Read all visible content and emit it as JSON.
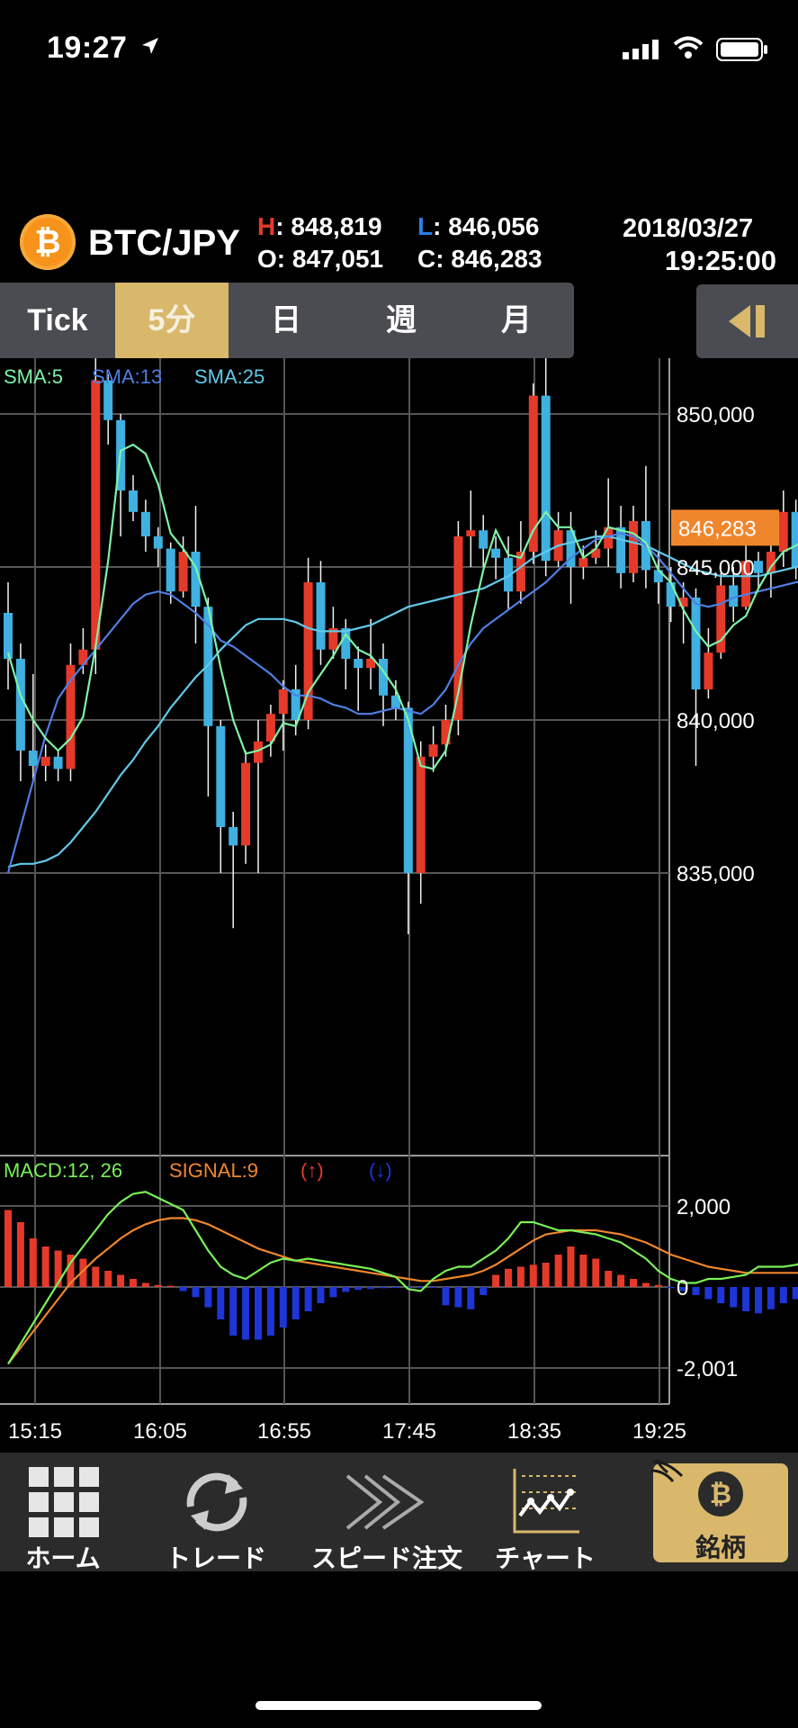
{
  "status_bar": {
    "time": "19:27"
  },
  "header": {
    "coin_symbol": "₿",
    "pair": "BTC/JPY",
    "high_key": "H",
    "high_value": ": 848,819",
    "low_key": "L",
    "low_value": ": 846,056",
    "open_key": "O",
    "open_value": ": 847,051",
    "close_key": "C",
    "close_value": ": 846,283",
    "date": "2018/03/27",
    "time": "19:25:00"
  },
  "tabs": [
    {
      "label": "Tick",
      "active": false
    },
    {
      "label": "5分",
      "active": true
    },
    {
      "label": "日",
      "active": false
    },
    {
      "label": "週",
      "active": false
    },
    {
      "label": "月",
      "active": false
    }
  ],
  "colors": {
    "up": "#e53a2a",
    "down": "#3fb0e0",
    "macd_pos": "#e53a2a",
    "macd_neg": "#1e35d8",
    "sma5": "#7ef2a6",
    "sma13": "#4f7fe3",
    "sma25": "#62c9e8",
    "macd_line": "#7af058",
    "signal_line": "#f0862c",
    "current_price_bg": "#f0862c",
    "accent_gold": "#d9b86c"
  },
  "chart_data": [
    {
      "type": "candlestick",
      "legend": [
        "SMA:5",
        "SMA:13",
        "SMA:25"
      ],
      "y_ticks": [
        "850,000",
        "845,000",
        "840,000",
        "835,000"
      ],
      "ylim": [
        832000,
        852000
      ],
      "current_price": "846,283",
      "x_ticks": [
        "15:15",
        "16:05",
        "16:55",
        "17:45",
        "18:35",
        "19:25"
      ],
      "candles": [
        [
          843500,
          842000,
          844500,
          841000
        ],
        [
          842000,
          839000,
          842500,
          838000
        ],
        [
          839000,
          838500,
          841500,
          838000
        ],
        [
          838500,
          838800,
          839200,
          838000
        ],
        [
          838800,
          838400,
          839000,
          838000
        ],
        [
          838400,
          841800,
          842500,
          838000
        ],
        [
          841800,
          842300,
          843000,
          841500
        ],
        [
          842300,
          851100,
          852500,
          841500
        ],
        [
          851100,
          849800,
          851300,
          849000
        ],
        [
          849800,
          847500,
          850000,
          846000
        ],
        [
          847500,
          846800,
          848000,
          846500
        ],
        [
          846800,
          846000,
          847200,
          845500
        ],
        [
          846000,
          845600,
          846300,
          845000
        ],
        [
          845600,
          844200,
          845800,
          843800
        ],
        [
          844200,
          845500,
          846000,
          844000
        ],
        [
          845500,
          843700,
          847000,
          842500
        ],
        [
          843700,
          839800,
          844000,
          837500
        ],
        [
          839800,
          836500,
          840000,
          835000
        ],
        [
          836500,
          835900,
          837000,
          833200
        ],
        [
          835900,
          838600,
          839000,
          835300
        ],
        [
          838600,
          839300,
          840000,
          835000
        ],
        [
          839300,
          840200,
          840500,
          838800
        ],
        [
          840200,
          841000,
          841300,
          839000
        ],
        [
          841000,
          840000,
          841800,
          839500
        ],
        [
          840000,
          844500,
          845300,
          839700
        ],
        [
          844500,
          842300,
          845200,
          841800
        ],
        [
          842300,
          843000,
          843700,
          842000
        ],
        [
          843000,
          842000,
          843300,
          841000
        ],
        [
          842000,
          841700,
          842400,
          840300
        ],
        [
          841700,
          842000,
          843300,
          841000
        ],
        [
          842000,
          840800,
          842500,
          839800
        ],
        [
          840800,
          840400,
          841300,
          840000
        ],
        [
          840400,
          835000,
          840600,
          833000
        ],
        [
          835000,
          838800,
          839300,
          834000
        ],
        [
          838800,
          839200,
          839800,
          838300
        ],
        [
          839200,
          840000,
          840500,
          838800
        ],
        [
          840000,
          846000,
          846500,
          839500
        ],
        [
          846000,
          846200,
          847500,
          845000
        ],
        [
          846200,
          845600,
          846700,
          845000
        ],
        [
          845600,
          845300,
          846000,
          844600
        ],
        [
          845300,
          844200,
          846000,
          843600
        ],
        [
          844200,
          845500,
          846500,
          843800
        ],
        [
          845500,
          850600,
          851000,
          845100
        ],
        [
          850600,
          845200,
          852000,
          844700
        ],
        [
          845200,
          846200,
          846800,
          845000
        ],
        [
          846200,
          845000,
          846800,
          843800
        ],
        [
          845000,
          845300,
          845700,
          844600
        ],
        [
          845300,
          845600,
          846200,
          845100
        ],
        [
          845600,
          846300,
          847900,
          845000
        ],
        [
          846300,
          844800,
          847000,
          844300
        ],
        [
          844800,
          846500,
          847000,
          844500
        ],
        [
          846500,
          844900,
          848300,
          844300
        ],
        [
          844900,
          844500,
          845500,
          843800
        ],
        [
          844500,
          843700,
          845000,
          843200
        ],
        [
          843700,
          844000,
          844500,
          842500
        ],
        [
          844000,
          841000,
          844300,
          838500
        ],
        [
          841000,
          842200,
          843000,
          840700
        ],
        [
          842200,
          844400,
          844800,
          842000
        ],
        [
          844400,
          843700,
          845000,
          843200
        ],
        [
          843700,
          845200,
          845700,
          843600
        ],
        [
          845200,
          844800,
          845500,
          844300
        ],
        [
          844800,
          845500,
          846000,
          844000
        ],
        [
          845500,
          846800,
          847500,
          845000
        ],
        [
          846800,
          845000,
          847200,
          844600
        ],
        [
          845000,
          846400,
          847300,
          844800
        ],
        [
          846400,
          847100,
          847600,
          846000
        ],
        [
          847100,
          846300,
          848800,
          846100
        ]
      ],
      "sma5": [
        842200,
        840800,
        840000,
        839400,
        839000,
        839400,
        840100,
        842400,
        845200,
        848800,
        849000,
        848700,
        847700,
        846100,
        845600,
        845000,
        843700,
        841700,
        840000,
        838900,
        839000,
        839200,
        839900,
        839800,
        840900,
        841500,
        842100,
        842800,
        842300,
        842100,
        841600,
        841000,
        840000,
        838500,
        838400,
        839000,
        840900,
        843100,
        844900,
        846200,
        845400,
        845300,
        846200,
        846800,
        846300,
        846300,
        845300,
        845600,
        846300,
        846200,
        846100,
        845800,
        844900,
        844500,
        843600,
        842900,
        842400,
        842600,
        843100,
        843400,
        844300,
        845000,
        845500,
        845700,
        846000,
        846500,
        846600
      ],
      "sma13": [
        835000,
        836500,
        838000,
        839500,
        840700,
        841300,
        841800,
        842300,
        842800,
        843300,
        843800,
        844100,
        844200,
        844100,
        843800,
        843500,
        843100,
        842600,
        842400,
        842100,
        841800,
        841500,
        841100,
        840800,
        840800,
        840700,
        840500,
        840400,
        840200,
        840200,
        840300,
        840400,
        840300,
        840200,
        840500,
        841000,
        841800,
        842500,
        843000,
        843300,
        843600,
        843900,
        844200,
        844500,
        844900,
        845300,
        845600,
        845900,
        846000,
        846100,
        846000,
        845700,
        845300,
        844800,
        844300,
        843800,
        843700,
        843800,
        844000,
        844100,
        844200,
        844300,
        844400,
        844500,
        844600,
        844700,
        844800
      ],
      "sma25": [
        835200,
        835300,
        835300,
        835400,
        835600,
        836000,
        836500,
        837000,
        837600,
        838200,
        838700,
        839300,
        839800,
        840400,
        840900,
        841400,
        841800,
        842300,
        842700,
        843100,
        843300,
        843300,
        843300,
        843200,
        843000,
        842900,
        842900,
        842900,
        843000,
        843100,
        843300,
        843500,
        843700,
        843800,
        843900,
        844000,
        844100,
        844200,
        844300,
        844500,
        844700,
        845000,
        845300,
        845500,
        845700,
        845800,
        845900,
        846000,
        846000,
        845900,
        845800,
        845700,
        845500,
        845300,
        845100,
        844900,
        844800,
        844700,
        844700,
        844700,
        844700,
        844800,
        844900,
        845000,
        845100,
        845200,
        845300
      ]
    },
    {
      "type": "macd",
      "legend": [
        "MACD:12, 26",
        "SIGNAL:9",
        "(↑)",
        "(↓)"
      ],
      "y_ticks": [
        "2,000",
        "0",
        "-2,001"
      ],
      "ylim": [
        -2001,
        2000
      ],
      "macd": [
        -1900,
        -1400,
        -900,
        -400,
        100,
        600,
        1000,
        1400,
        1800,
        2100,
        2300,
        2350,
        2200,
        2050,
        1900,
        1400,
        900,
        500,
        300,
        200,
        400,
        600,
        700,
        650,
        700,
        650,
        600,
        550,
        500,
        450,
        350,
        250,
        -50,
        -100,
        200,
        400,
        500,
        500,
        700,
        900,
        1200,
        1600,
        1600,
        1500,
        1400,
        1400,
        1350,
        1300,
        1200,
        1100,
        900,
        700,
        400,
        200,
        100,
        100,
        200,
        200,
        250,
        300,
        500,
        500,
        500,
        550,
        650,
        700,
        750
      ],
      "signal": [
        -1900,
        -1500,
        -1100,
        -700,
        -300,
        100,
        400,
        700,
        950,
        1200,
        1400,
        1550,
        1650,
        1700,
        1700,
        1650,
        1550,
        1400,
        1250,
        1100,
        950,
        850,
        750,
        650,
        600,
        550,
        500,
        450,
        400,
        350,
        300,
        250,
        200,
        150,
        150,
        200,
        250,
        300,
        400,
        550,
        750,
        950,
        1150,
        1300,
        1350,
        1400,
        1400,
        1400,
        1350,
        1300,
        1200,
        1100,
        950,
        800,
        700,
        600,
        500,
        450,
        400,
        350,
        350,
        350,
        350,
        350,
        350,
        350,
        350
      ],
      "histogram": [
        1900,
        1600,
        1200,
        1000,
        900,
        800,
        700,
        500,
        400,
        300,
        200,
        100,
        50,
        30,
        -100,
        -250,
        -500,
        -800,
        -1200,
        -1300,
        -1300,
        -1200,
        -1000,
        -800,
        -600,
        -400,
        -250,
        -120,
        -70,
        -50,
        -30,
        -20,
        -10,
        -10,
        -20,
        -450,
        -500,
        -550,
        -200,
        300,
        450,
        500,
        550,
        600,
        800,
        1000,
        800,
        700,
        400,
        300,
        200,
        100,
        50,
        -30,
        -100,
        -200,
        -300,
        -400,
        -500,
        -600,
        -650,
        -550,
        -400,
        -300,
        -200,
        -100,
        300
      ]
    }
  ],
  "nav": [
    {
      "label": "ホーム",
      "icon": "grid-icon"
    },
    {
      "label": "トレード",
      "icon": "refresh-icon"
    },
    {
      "label": "スピード注文",
      "icon": "speed-arrow-icon"
    },
    {
      "label": "チャート",
      "icon": "chart-icon"
    },
    {
      "label": "銘柄",
      "icon": "bitcoin-icon",
      "active": true
    }
  ]
}
